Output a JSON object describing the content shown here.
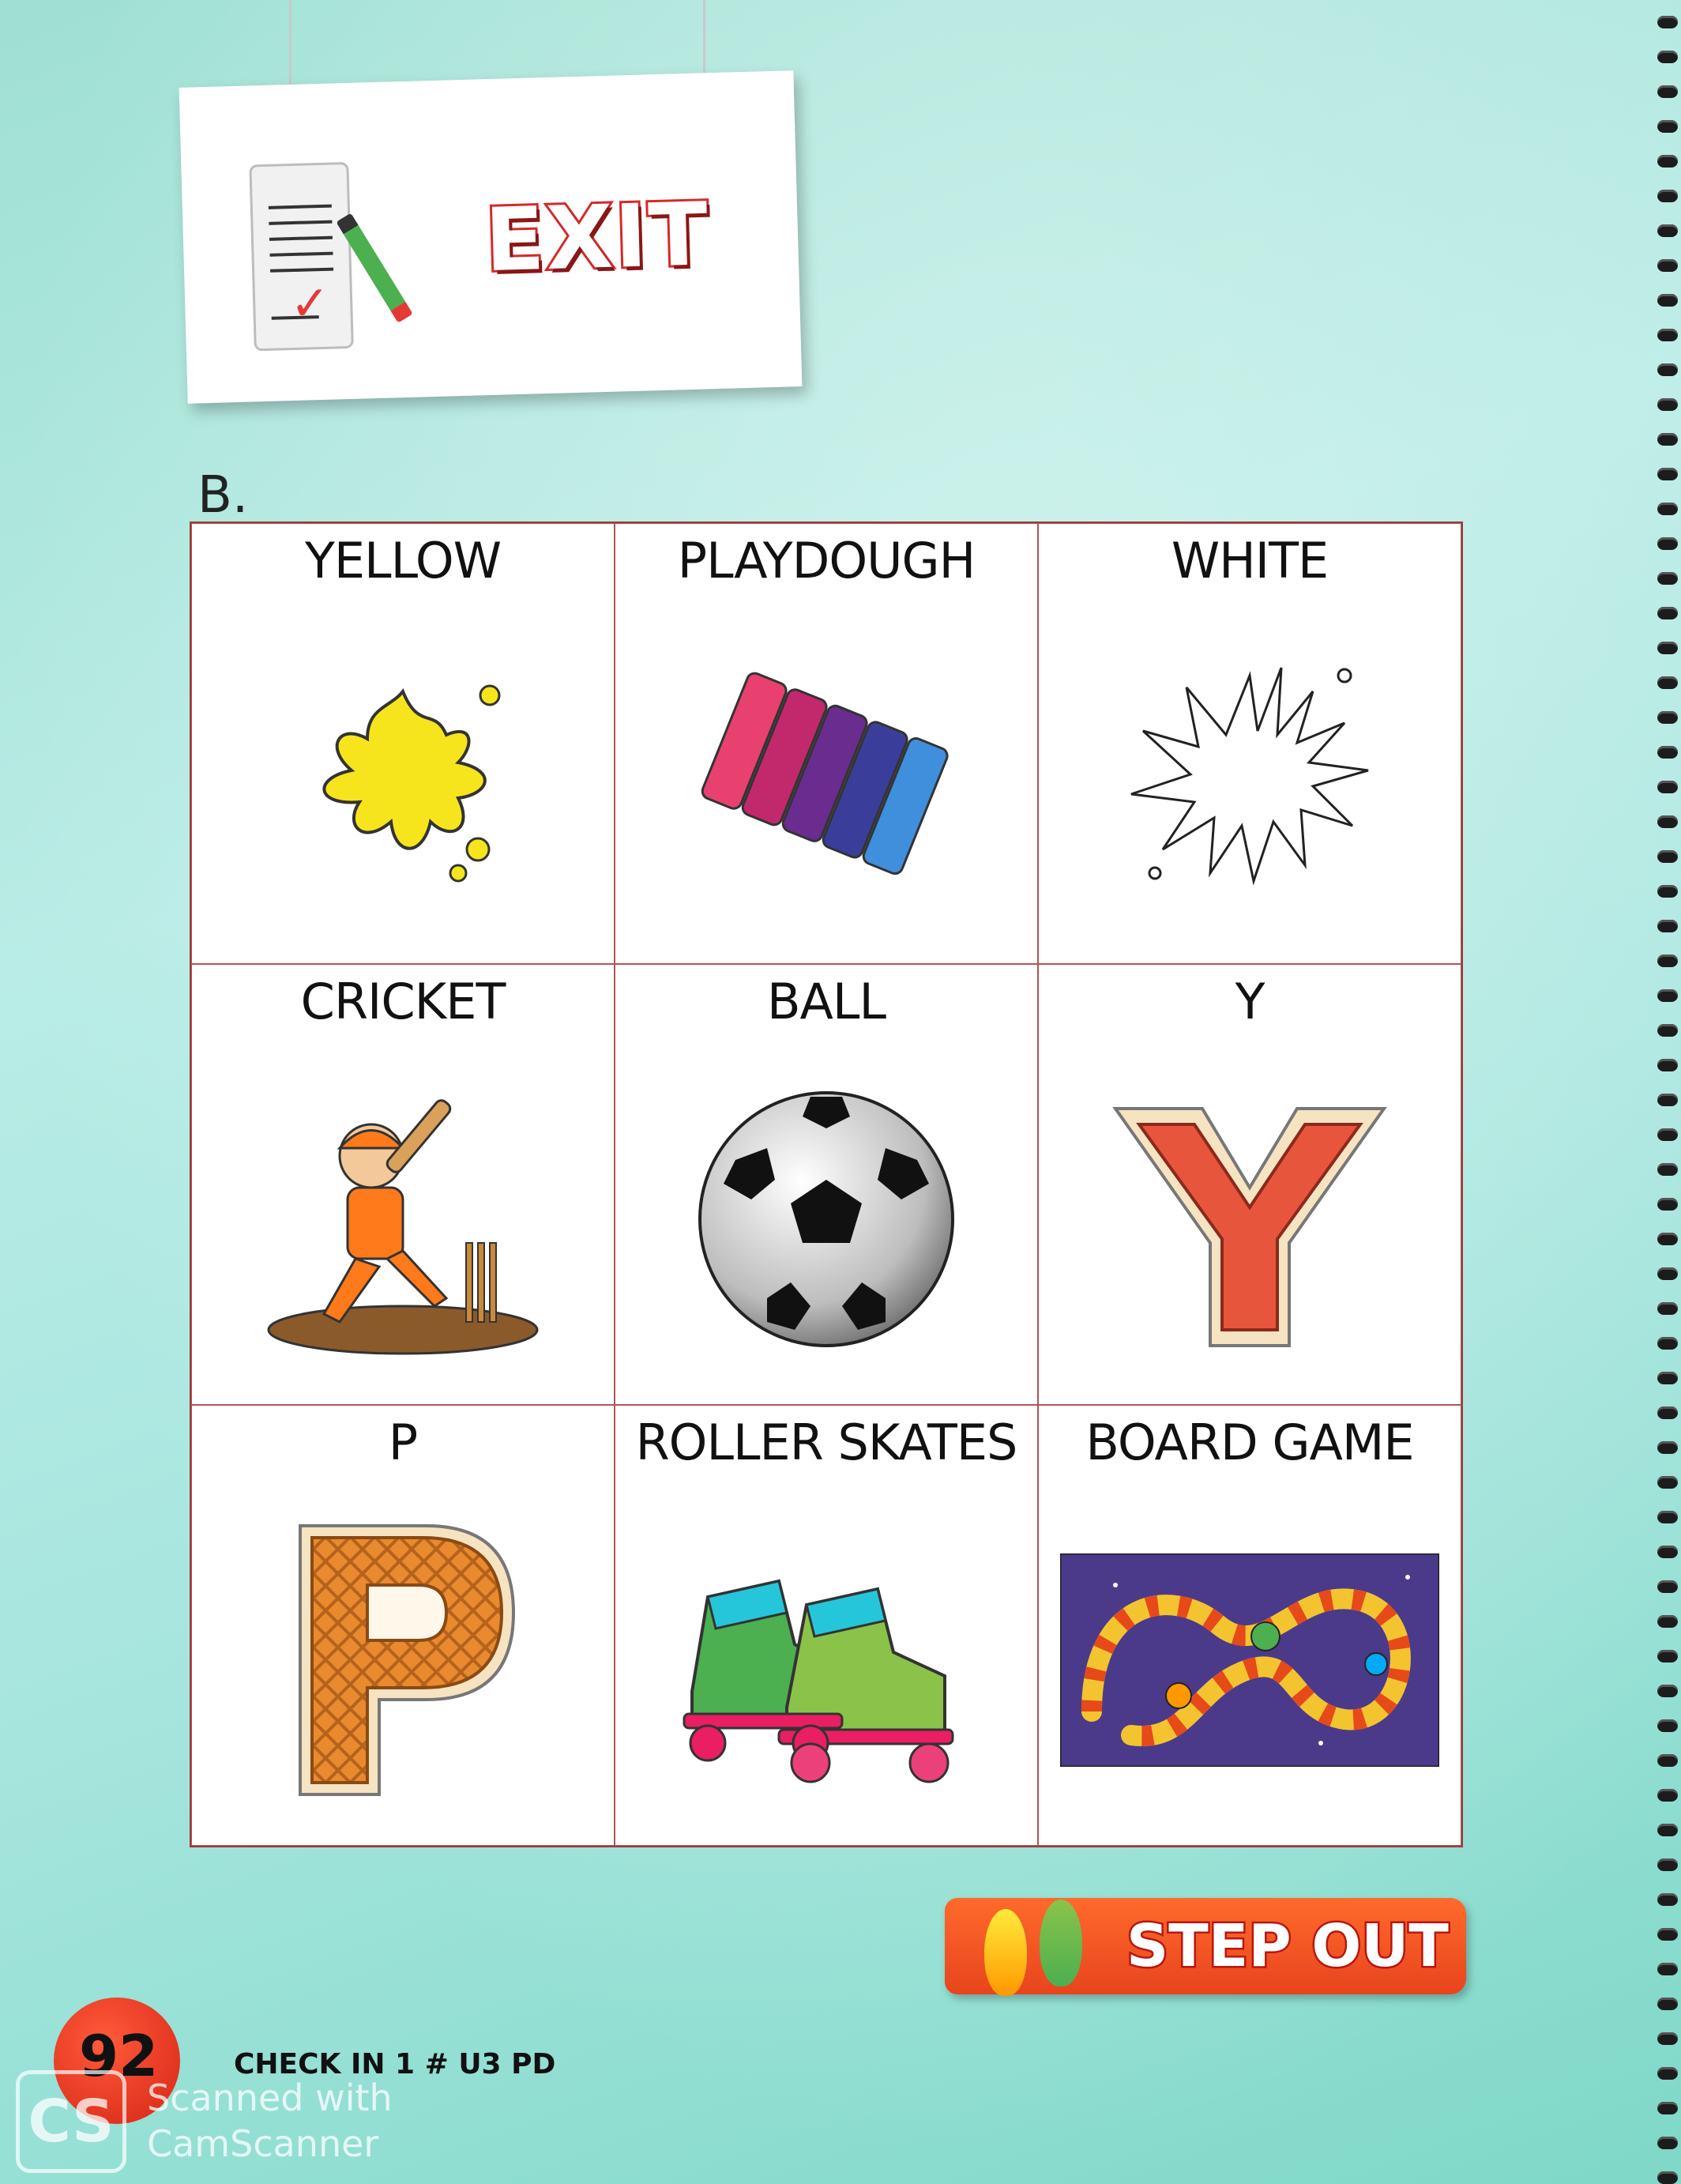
{
  "sign": {
    "title": "EXIT"
  },
  "section": {
    "label": "B."
  },
  "grid": {
    "cells": [
      {
        "label": "YELLOW"
      },
      {
        "label": "PLAYDOUGH"
      },
      {
        "label": "WHITE"
      },
      {
        "label": "CRICKET"
      },
      {
        "label": "BALL"
      },
      {
        "label": "Y"
      },
      {
        "label": "P"
      },
      {
        "label": "ROLLER SKATES"
      },
      {
        "label": "BOARD GAME"
      }
    ]
  },
  "step_out": {
    "label": "STEP OUT"
  },
  "footer": {
    "page_number": "92",
    "book_code": "CHECK IN 1 # U3 PD",
    "watermark_line1": "Scanned with",
    "watermark_line2": "CamScanner",
    "watermark_logo": "CS"
  },
  "colors": {
    "accent_red": "#d62828",
    "step_out_orange": "#ff6a2b",
    "background_teal": "#a8e6df",
    "grid_border": "#9b3b3b"
  }
}
